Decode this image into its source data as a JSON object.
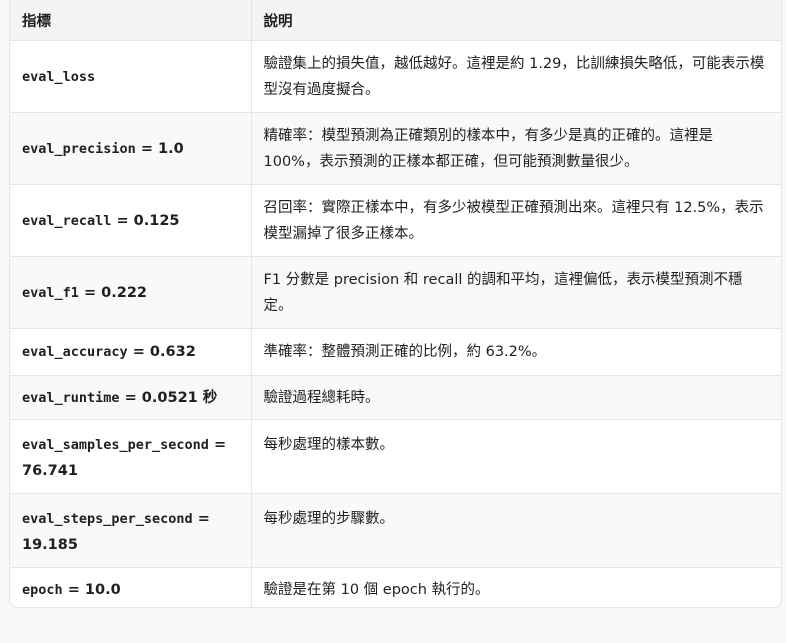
{
  "header": {
    "col_metric": "指標",
    "col_desc": "說明"
  },
  "rows": [
    {
      "code": "eval_loss",
      "value": "",
      "desc": "驗證集上的損失值，越低越好。這裡是約 1.29，比訓練損失略低，可能表示模型沒有過度擬合。"
    },
    {
      "code": "eval_precision",
      "value": " = 1.0",
      "desc": "精確率：模型預測為正確類別的樣本中，有多少是真的正確的。這裡是 100%，表示預測的正樣本都正確，但可能預測數量很少。"
    },
    {
      "code": "eval_recall",
      "value": " = 0.125",
      "desc": "召回率：實際正樣本中，有多少被模型正確預測出來。這裡只有 12.5%，表示模型漏掉了很多正樣本。"
    },
    {
      "code": "eval_f1",
      "value": " = 0.222",
      "desc": "F1 分數是 precision 和 recall 的調和平均，這裡偏低，表示模型預測不穩定。"
    },
    {
      "code": "eval_accuracy",
      "value": " = 0.632",
      "desc": "準確率：整體預測正確的比例，約 63.2%。"
    },
    {
      "code": "eval_runtime",
      "value": " = 0.0521 秒",
      "desc": "驗證過程總耗時。"
    },
    {
      "code": "eval_samples_per_second",
      "value": " = 76.741",
      "desc": "每秒處理的樣本數。"
    },
    {
      "code": "eval_steps_per_second",
      "value": " = 19.185",
      "desc": "每秒處理的步驟數。"
    },
    {
      "code": "epoch",
      "value": " = 10.0",
      "desc": "驗證是在第 10 個 epoch 執行的。"
    }
  ]
}
